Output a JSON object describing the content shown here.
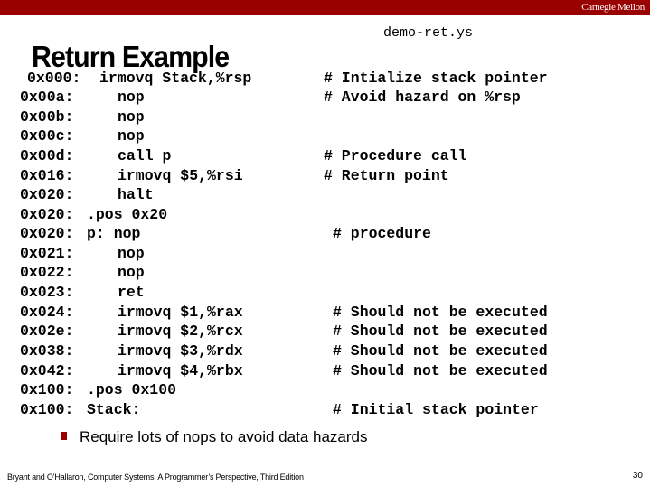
{
  "header": {
    "brand": "Carnegie Mellon"
  },
  "filename": "demo-ret.ys",
  "title": "Return Example",
  "code_lines": [
    {
      "addr": "0x000:",
      "instr": "irmovq Stack,%rsp",
      "comment": "# Intialize stack pointer"
    },
    {
      "addr": "0x00a:",
      "instr": "nop",
      "comment": "# Avoid hazard on %rsp"
    },
    {
      "addr": "0x00b:",
      "instr": "nop",
      "comment": ""
    },
    {
      "addr": "0x00c:",
      "instr": "nop",
      "comment": ""
    },
    {
      "addr": "0x00d:",
      "instr": "call p",
      "comment": "# Procedure call"
    },
    {
      "addr": "0x016:",
      "instr": "irmovq $5,%rsi",
      "comment": "# Return point"
    },
    {
      "addr": "0x020:",
      "instr": "halt",
      "comment": ""
    },
    {
      "addr": "0x020:",
      "instr": ".pos 0x20",
      "comment": ""
    },
    {
      "addr": "0x020:",
      "instr": "p: nop",
      "comment": "# procedure"
    },
    {
      "addr": "0x021:",
      "instr": "nop",
      "comment": ""
    },
    {
      "addr": "0x022:",
      "instr": "nop",
      "comment": ""
    },
    {
      "addr": "0x023:",
      "instr": "ret",
      "comment": ""
    },
    {
      "addr": "0x024:",
      "instr": "irmovq $1,%rax",
      "comment": "# Should not be executed"
    },
    {
      "addr": "0x02e:",
      "instr": "irmovq $2,%rcx",
      "comment": "# Should not be executed"
    },
    {
      "addr": "0x038:",
      "instr": "irmovq $3,%rdx",
      "comment": "# Should not be executed"
    },
    {
      "addr": "0x042:",
      "instr": "irmovq $4,%rbx",
      "comment": "# Should not be executed"
    },
    {
      "addr": "0x100:",
      "instr": ".pos 0x100",
      "comment": ""
    },
    {
      "addr": "0x100:",
      "instr": "Stack:",
      "comment": ""
    },
    {
      "addr": "",
      "instr": "",
      "comment": "# Initial stack pointer"
    }
  ],
  "bullets": [
    "Require lots of nops to avoid data hazards"
  ],
  "footer": {
    "citation": "Bryant and O’Hallaron, Computer Systems: A Programmer’s Perspective, Third Edition",
    "page_number": "30"
  },
  "colors": {
    "accent": "#990000"
  }
}
